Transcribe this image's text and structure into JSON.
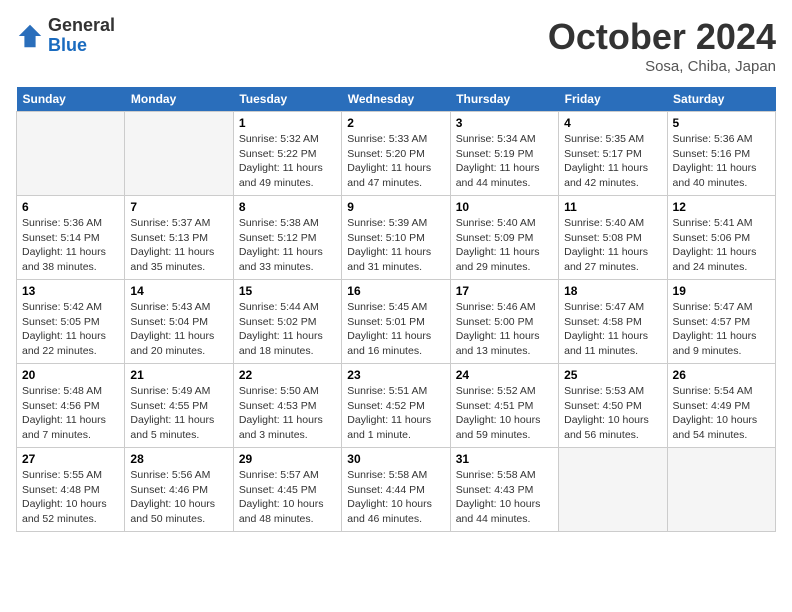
{
  "header": {
    "logo": {
      "general": "General",
      "blue": "Blue"
    },
    "title": "October 2024",
    "location": "Sosa, Chiba, Japan"
  },
  "weekdays": [
    "Sunday",
    "Monday",
    "Tuesday",
    "Wednesday",
    "Thursday",
    "Friday",
    "Saturday"
  ],
  "weeks": [
    [
      {
        "day": null
      },
      {
        "day": null
      },
      {
        "day": 1,
        "sunrise": "5:32 AM",
        "sunset": "5:22 PM",
        "daylight": "11 hours and 49 minutes."
      },
      {
        "day": 2,
        "sunrise": "5:33 AM",
        "sunset": "5:20 PM",
        "daylight": "11 hours and 47 minutes."
      },
      {
        "day": 3,
        "sunrise": "5:34 AM",
        "sunset": "5:19 PM",
        "daylight": "11 hours and 44 minutes."
      },
      {
        "day": 4,
        "sunrise": "5:35 AM",
        "sunset": "5:17 PM",
        "daylight": "11 hours and 42 minutes."
      },
      {
        "day": 5,
        "sunrise": "5:36 AM",
        "sunset": "5:16 PM",
        "daylight": "11 hours and 40 minutes."
      }
    ],
    [
      {
        "day": 6,
        "sunrise": "5:36 AM",
        "sunset": "5:14 PM",
        "daylight": "11 hours and 38 minutes."
      },
      {
        "day": 7,
        "sunrise": "5:37 AM",
        "sunset": "5:13 PM",
        "daylight": "11 hours and 35 minutes."
      },
      {
        "day": 8,
        "sunrise": "5:38 AM",
        "sunset": "5:12 PM",
        "daylight": "11 hours and 33 minutes."
      },
      {
        "day": 9,
        "sunrise": "5:39 AM",
        "sunset": "5:10 PM",
        "daylight": "11 hours and 31 minutes."
      },
      {
        "day": 10,
        "sunrise": "5:40 AM",
        "sunset": "5:09 PM",
        "daylight": "11 hours and 29 minutes."
      },
      {
        "day": 11,
        "sunrise": "5:40 AM",
        "sunset": "5:08 PM",
        "daylight": "11 hours and 27 minutes."
      },
      {
        "day": 12,
        "sunrise": "5:41 AM",
        "sunset": "5:06 PM",
        "daylight": "11 hours and 24 minutes."
      }
    ],
    [
      {
        "day": 13,
        "sunrise": "5:42 AM",
        "sunset": "5:05 PM",
        "daylight": "11 hours and 22 minutes."
      },
      {
        "day": 14,
        "sunrise": "5:43 AM",
        "sunset": "5:04 PM",
        "daylight": "11 hours and 20 minutes."
      },
      {
        "day": 15,
        "sunrise": "5:44 AM",
        "sunset": "5:02 PM",
        "daylight": "11 hours and 18 minutes."
      },
      {
        "day": 16,
        "sunrise": "5:45 AM",
        "sunset": "5:01 PM",
        "daylight": "11 hours and 16 minutes."
      },
      {
        "day": 17,
        "sunrise": "5:46 AM",
        "sunset": "5:00 PM",
        "daylight": "11 hours and 13 minutes."
      },
      {
        "day": 18,
        "sunrise": "5:47 AM",
        "sunset": "4:58 PM",
        "daylight": "11 hours and 11 minutes."
      },
      {
        "day": 19,
        "sunrise": "5:47 AM",
        "sunset": "4:57 PM",
        "daylight": "11 hours and 9 minutes."
      }
    ],
    [
      {
        "day": 20,
        "sunrise": "5:48 AM",
        "sunset": "4:56 PM",
        "daylight": "11 hours and 7 minutes."
      },
      {
        "day": 21,
        "sunrise": "5:49 AM",
        "sunset": "4:55 PM",
        "daylight": "11 hours and 5 minutes."
      },
      {
        "day": 22,
        "sunrise": "5:50 AM",
        "sunset": "4:53 PM",
        "daylight": "11 hours and 3 minutes."
      },
      {
        "day": 23,
        "sunrise": "5:51 AM",
        "sunset": "4:52 PM",
        "daylight": "11 hours and 1 minute."
      },
      {
        "day": 24,
        "sunrise": "5:52 AM",
        "sunset": "4:51 PM",
        "daylight": "10 hours and 59 minutes."
      },
      {
        "day": 25,
        "sunrise": "5:53 AM",
        "sunset": "4:50 PM",
        "daylight": "10 hours and 56 minutes."
      },
      {
        "day": 26,
        "sunrise": "5:54 AM",
        "sunset": "4:49 PM",
        "daylight": "10 hours and 54 minutes."
      }
    ],
    [
      {
        "day": 27,
        "sunrise": "5:55 AM",
        "sunset": "4:48 PM",
        "daylight": "10 hours and 52 minutes."
      },
      {
        "day": 28,
        "sunrise": "5:56 AM",
        "sunset": "4:46 PM",
        "daylight": "10 hours and 50 minutes."
      },
      {
        "day": 29,
        "sunrise": "5:57 AM",
        "sunset": "4:45 PM",
        "daylight": "10 hours and 48 minutes."
      },
      {
        "day": 30,
        "sunrise": "5:58 AM",
        "sunset": "4:44 PM",
        "daylight": "10 hours and 46 minutes."
      },
      {
        "day": 31,
        "sunrise": "5:58 AM",
        "sunset": "4:43 PM",
        "daylight": "10 hours and 44 minutes."
      },
      {
        "day": null
      },
      {
        "day": null
      }
    ]
  ]
}
